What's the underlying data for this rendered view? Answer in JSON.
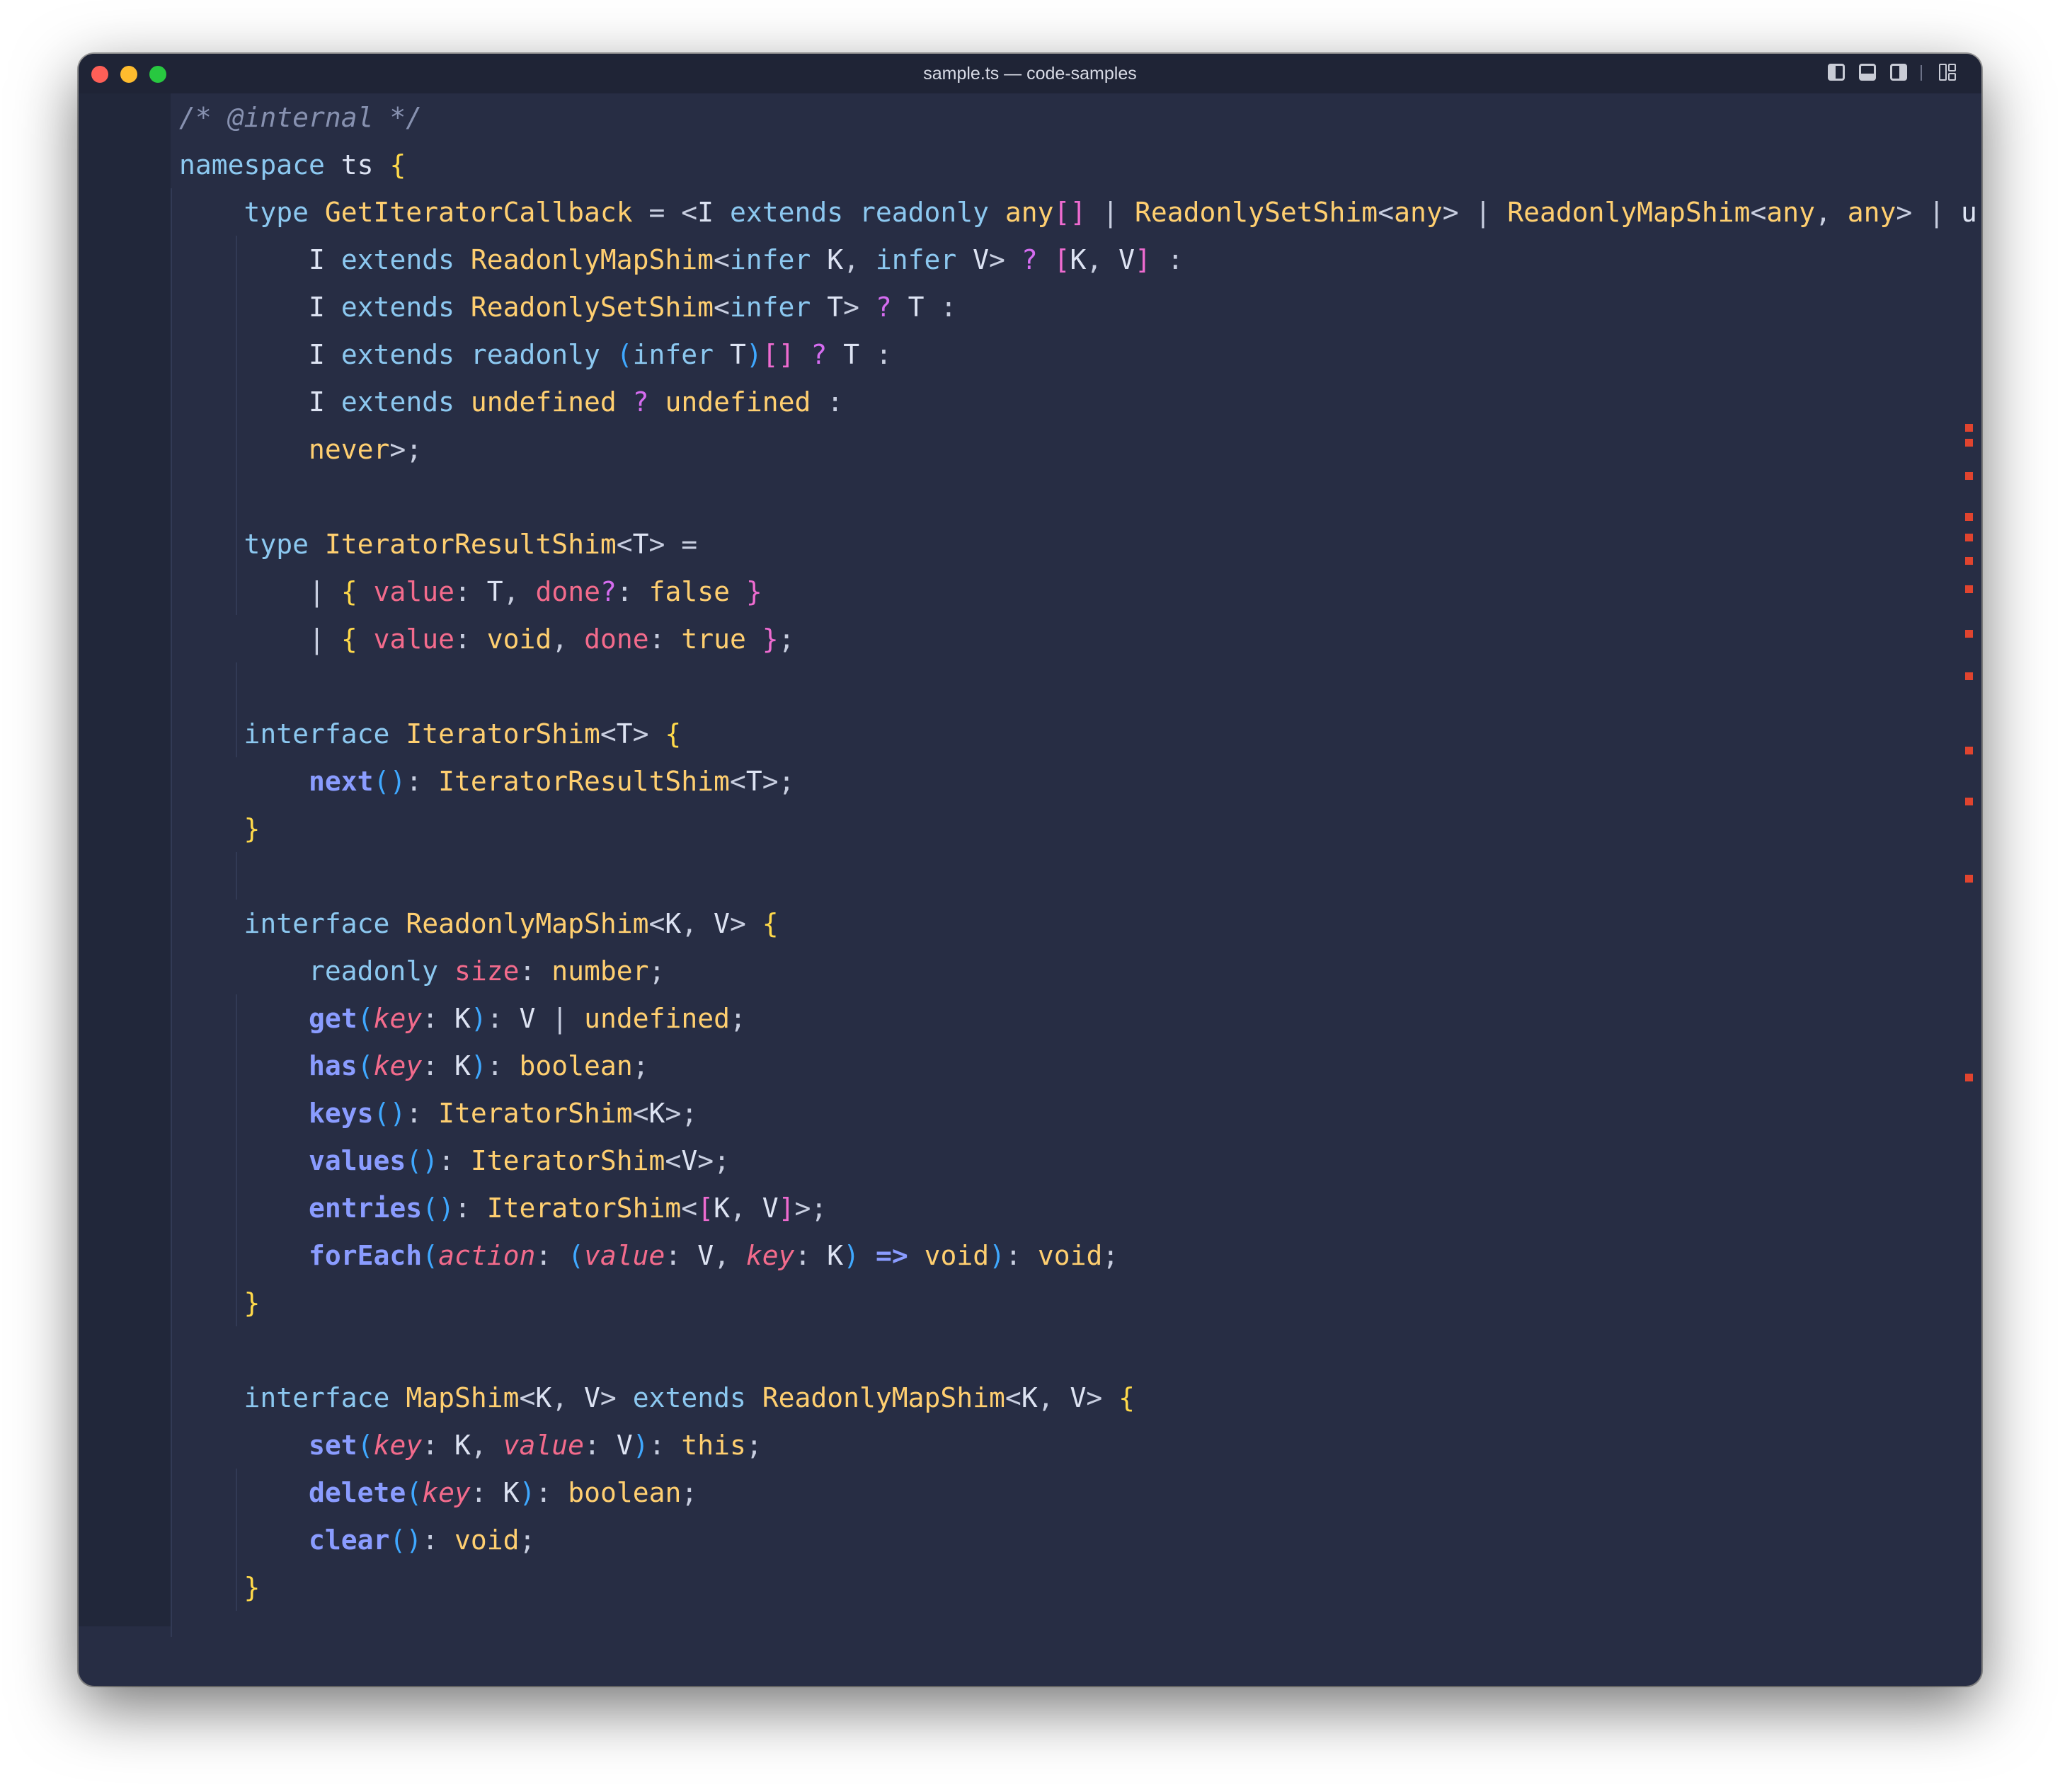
{
  "window": {
    "title": "sample.ts — code-samples"
  },
  "titlebar_icons": [
    "toggle-primary-sidebar-icon",
    "toggle-panel-icon",
    "toggle-secondary-sidebar-icon",
    "customize-layout-icon"
  ],
  "code": {
    "language": "typescript",
    "lines": [
      "/* @internal */",
      "namespace ts {",
      "    type GetIteratorCallback = <I extends readonly any[] | ReadonlySetShim<any> | ReadonlyMapShim<any, any> | u",
      "        I extends ReadonlyMapShim<infer K, infer V> ? [K, V] :",
      "        I extends ReadonlySetShim<infer T> ? T :",
      "        I extends readonly (infer T)[] ? T :",
      "        I extends undefined ? undefined :",
      "        never>;",
      "",
      "    type IteratorResultShim<T> =",
      "        | { value: T, done?: false }",
      "        | { value: void, done: true };",
      "",
      "    interface IteratorShim<T> {",
      "        next(): IteratorResultShim<T>;",
      "    }",
      "",
      "    interface ReadonlyMapShim<K, V> {",
      "        readonly size: number;",
      "        get(key: K): V | undefined;",
      "        has(key: K): boolean;",
      "        keys(): IteratorShim<K>;",
      "        values(): IteratorShim<V>;",
      "        entries(): IteratorShim<[K, V]>;",
      "        forEach(action: (value: V, key: K) => void): void;",
      "    }",
      "",
      "    interface MapShim<K, V> extends ReadonlyMapShim<K, V> {",
      "        set(key: K, value: V): this;",
      "        delete(key: K): boolean;",
      "        clear(): void;",
      "    }"
    ]
  },
  "colors": {
    "background": "#272d44",
    "titlebar": "#1f2436",
    "keyword": "#8cc8f0",
    "type": "#ffcf70",
    "property": "#f36b8c",
    "method": "#8a9cff",
    "comment": "#8791b0",
    "scroll_marker": "#e0442f"
  }
}
